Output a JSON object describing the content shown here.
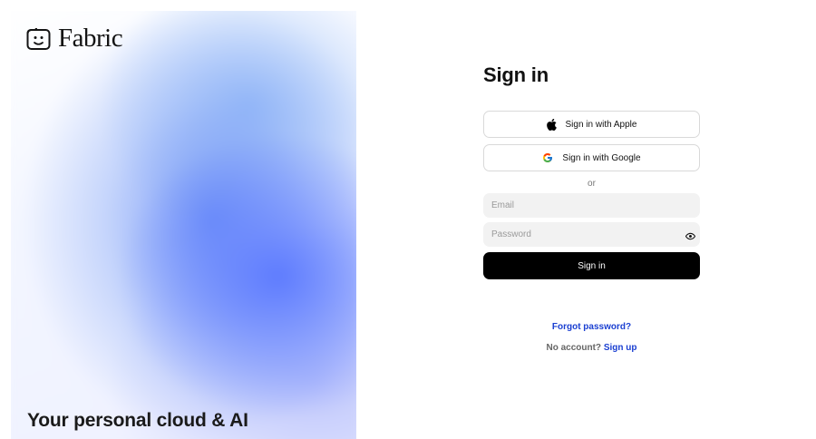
{
  "brand": {
    "name": "Fabric",
    "logo_icon": "smiley-face-icon"
  },
  "hero": {
    "tagline": "Your personal cloud & AI"
  },
  "signin": {
    "title": "Sign in",
    "apple_label": "Sign in with Apple",
    "google_label": "Sign in with Google",
    "divider": "or",
    "email_placeholder": "Email",
    "password_placeholder": "Password",
    "submit_label": "Sign in",
    "forgot_label": "Forgot password?",
    "no_account_text": "No account?",
    "signup_label": "Sign up"
  },
  "colors": {
    "accent_link": "#1a3fd1",
    "primary_button": "#000000",
    "field_bg": "#f2f2f2"
  },
  "icons": [
    "apple-icon",
    "google-icon",
    "eye-icon"
  ]
}
